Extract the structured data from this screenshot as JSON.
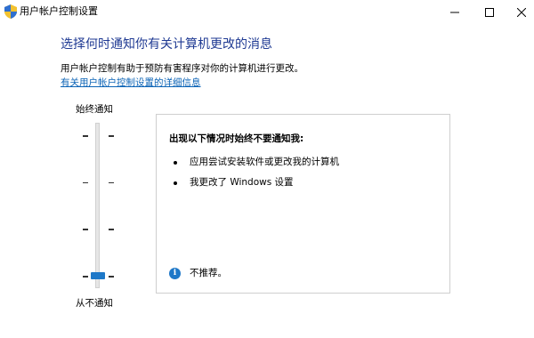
{
  "window": {
    "title": "用户帐户控制设置",
    "icon": "uac-shield-icon"
  },
  "caption": {
    "minimize_icon": "minimize-icon",
    "maximize_icon": "maximize-icon",
    "close_icon": "close-icon"
  },
  "main": {
    "heading": "选择何时通知你有关计算机更改的消息",
    "description": "用户帐户控制有助于预防有害程序对你的计算机进行更改。",
    "link": "有关用户帐户控制设置的详细信息"
  },
  "slider": {
    "top_label": "始终通知",
    "bottom_label": "从不通知",
    "levels": 4,
    "selected_level": 1,
    "accent_color": "#1e78c8"
  },
  "panel": {
    "title": "出现以下情况时始终不要通知我:",
    "items": [
      "应用尝试安装软件或更改我的计算机",
      "我更改了 Windows 设置"
    ],
    "footer_icon": "info-icon",
    "footer_text": "不推荐。"
  },
  "colors": {
    "heading": "#1f3a93",
    "link": "#0b63b6"
  }
}
